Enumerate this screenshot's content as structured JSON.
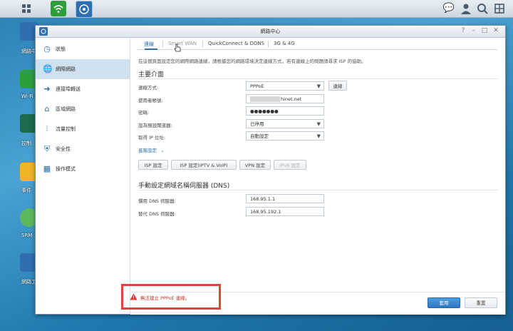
{
  "window": {
    "title": "網路中心"
  },
  "desktop": {
    "icons": [
      {
        "label": "網路中",
        "icon": "network-center-icon"
      },
      {
        "label": "Wi-Fi C",
        "icon": "wifi-icon"
      },
      {
        "label": "控制",
        "icon": "control-panel-icon"
      },
      {
        "label": "事件",
        "icon": "folder-icon"
      },
      {
        "label": "SRM",
        "icon": "help-icon"
      },
      {
        "label": "網路工",
        "icon": "tools-icon"
      }
    ]
  },
  "sidebar": {
    "items": [
      {
        "label": "狀態",
        "icon": "status-icon"
      },
      {
        "label": "網際網路",
        "icon": "globe-icon"
      },
      {
        "label": "連接埠轉送",
        "icon": "port-forward-icon"
      },
      {
        "label": "區域網路",
        "icon": "home-network-icon"
      },
      {
        "label": "流量控制",
        "icon": "traffic-control-icon"
      },
      {
        "label": "安全性",
        "icon": "shield-icon"
      },
      {
        "label": "操作模式",
        "icon": "mode-icon"
      }
    ]
  },
  "tabs": [
    {
      "label": "連線"
    },
    {
      "label": "Smart WAN"
    },
    {
      "label": "QuickConnect & DDNS"
    },
    {
      "label": "3G & 4G"
    }
  ],
  "description": "在這個頁面設定您的網際網路連線，請根據您的網路環境決定連線方式，若有連線上的問題請尋求 ISP 的協助。",
  "primary": {
    "title": "主要介面",
    "connection_label": "連線方式:",
    "connection_value": "PPPoE",
    "connect_button": "連線",
    "username_label": "使用者帳號:",
    "username_value": "hinet.net",
    "password_label": "密碼:",
    "password_value": "●●●●●●●",
    "default_gateway_label": "設為預設閘道器:",
    "default_gateway_value": "已停用",
    "ip_label": "取得 IP 位址:",
    "ip_value": "自動設定",
    "advanced_label": "進階設定"
  },
  "setting_buttons": [
    {
      "label": "ISP 設定",
      "enabled": true
    },
    {
      "label": "ISP 設定(IPTV & VoIP)",
      "enabled": true
    },
    {
      "label": "VPN 設定",
      "enabled": true
    },
    {
      "label": "IPv6 設定",
      "enabled": false
    }
  ],
  "dns": {
    "title": "手動設定網域名稱伺服器 (DNS)",
    "preferred_label": "慣用 DNS 伺服器:",
    "preferred_value": "168.95.1.1",
    "alternate_label": "替代 DNS 伺服器:",
    "alternate_value": "168.95.192.1"
  },
  "footer": {
    "warning": "無法建立 PPPoE 連線。",
    "apply_label": "套用",
    "reset_label": "重置"
  },
  "colors": {
    "accent": "#2d77c2",
    "warning": "#c0392b",
    "highlight": "#e0443e"
  }
}
